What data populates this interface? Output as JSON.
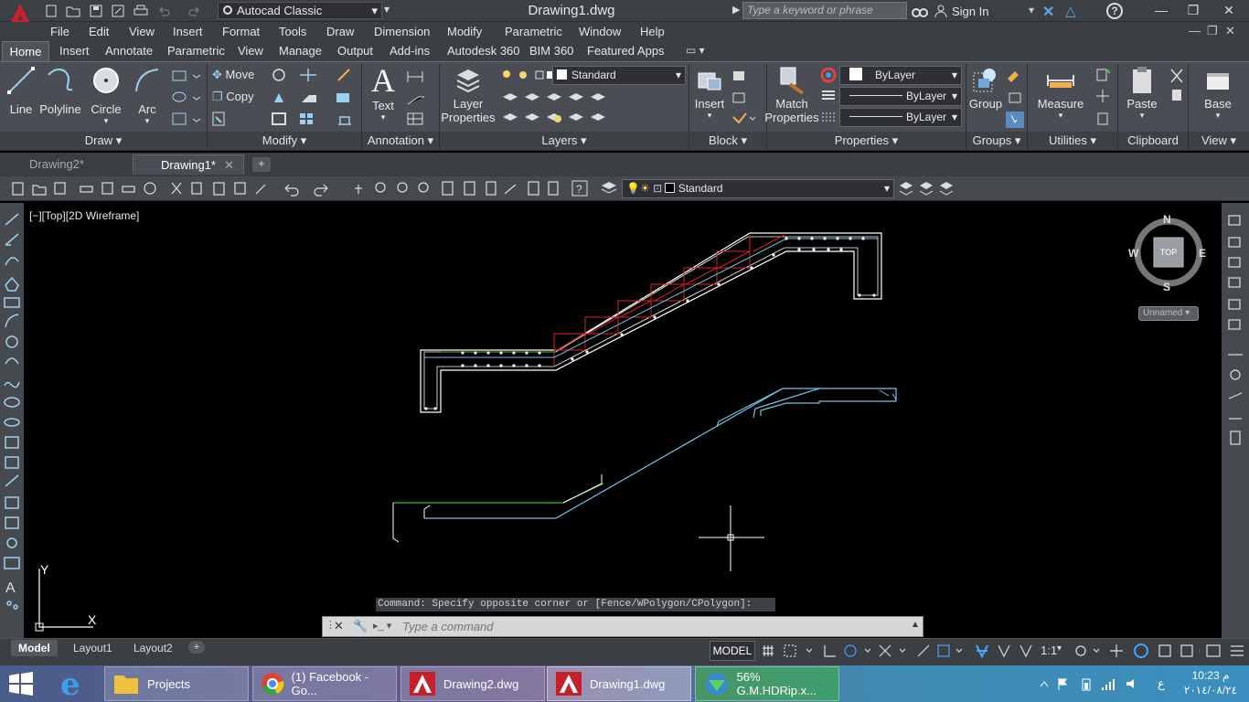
{
  "app": {
    "workspace": "Autocad Classic",
    "document_title": "Drawing1.dwg",
    "search_placeholder": "Type a keyword or phrase",
    "sign_in": "Sign In"
  },
  "menu": [
    "File",
    "Edit",
    "View",
    "Insert",
    "Format",
    "Tools",
    "Draw",
    "Dimension",
    "Modify",
    "Parametric",
    "Window",
    "Help"
  ],
  "ribbon_tabs": [
    "Home",
    "Insert",
    "Annotate",
    "Parametric",
    "View",
    "Manage",
    "Output",
    "Add-ins",
    "Autodesk 360",
    "BIM 360",
    "Featured Apps"
  ],
  "ribbon": {
    "draw": {
      "panel": "Draw",
      "line": "Line",
      "polyline": "Polyline",
      "circle": "Circle",
      "arc": "Arc"
    },
    "modify": {
      "panel": "Modify",
      "move": "Move",
      "copy": "Copy"
    },
    "annotation": {
      "panel": "Annotation",
      "text": "Text"
    },
    "layers": {
      "panel": "Layers",
      "layer_properties_1": "Layer",
      "layer_properties_2": "Properties",
      "layer_combo": "Standard"
    },
    "block": {
      "panel": "Block",
      "insert": "Insert"
    },
    "properties": {
      "panel": "Properties",
      "match_1": "Match",
      "match_2": "Properties",
      "color": "ByLayer",
      "linetype": "ByLayer",
      "lineweight": "ByLayer"
    },
    "groups": {
      "panel": "Groups",
      "group": "Group"
    },
    "utilities": {
      "panel": "Utilities",
      "measure": "Measure"
    },
    "clipboard": {
      "panel": "Clipboard",
      "paste": "Paste"
    },
    "view": {
      "panel": "View",
      "base": "Base"
    }
  },
  "file_tabs": {
    "tab1": "Drawing2*",
    "tab2": "Drawing1*"
  },
  "toolbar": {
    "layer_state": "Standard"
  },
  "viewport": {
    "label": "[−][Top][2D Wireframe]"
  },
  "viewcube": {
    "n": "N",
    "s": "S",
    "e": "E",
    "w": "W",
    "top": "TOP",
    "ucs": "Unnamed"
  },
  "ucs_icon": {
    "x": "X",
    "y": "Y"
  },
  "command": {
    "history": "Command: Specify opposite corner or [Fence/WPolygon/CPolygon]:",
    "placeholder": "Type a command"
  },
  "layout_tabs": [
    "Model",
    "Layout1",
    "Layout2"
  ],
  "status": {
    "model": "MODEL",
    "scale": "1:1"
  },
  "taskbar": {
    "items": [
      "Projects",
      "(1) Facebook - Go...",
      "Drawing2.dwg",
      "Drawing1.dwg",
      "56% G.M.HDRip.x..."
    ],
    "time": "10:23 م",
    "date": "٢٠١٤/٠٨/٢٤",
    "lang": "ع"
  },
  "colors": {
    "accent_red": "#c8202a",
    "line_cyan": "#6fc3e6",
    "line_red": "#e02020",
    "line_green": "#3cbf3c"
  }
}
